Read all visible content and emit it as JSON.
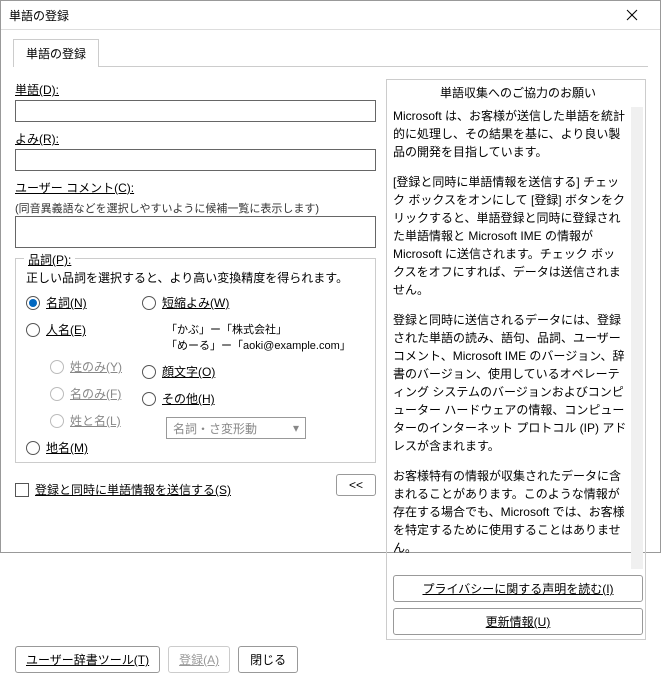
{
  "title": "単語の登録",
  "tab": "単語の登録",
  "fields": {
    "word_label": "単語(D):",
    "yomi_label": "よみ(R):",
    "comment_label": "ユーザー コメント(C):",
    "comment_hint": "(同音異義語などを選択しやすいように候補一覧に表示します)"
  },
  "pos": {
    "title": "品詞(P):",
    "desc": "正しい品詞を選択すると、より高い変換精度を得られます。",
    "noun": "名詞(N)",
    "person": "人名(E)",
    "surname_only": "姓のみ(Y)",
    "givenname_only": "名のみ(F)",
    "fullname": "姓と名(L)",
    "place": "地名(M)",
    "shortyomi": "短縮よみ(W)",
    "example1": "「かぶ」ー「株式会社」",
    "example2": "「めーる」ー「aoki@example.com」",
    "kaomoji": "顔文字(O)",
    "other": "その他(H)",
    "select_value": "名詞・さ変形動"
  },
  "send_checkbox": "登録と同時に単語情報を送信する(S)",
  "collapse_btn": "<<",
  "buttons": {
    "user_dict": "ユーザー辞書ツール(T)",
    "register": "登録(A)",
    "close": "閉じる"
  },
  "right": {
    "title": "単語収集へのご協力のお願い",
    "p1": "Microsoft は、お客様が送信した単語を統計的に処理し、その結果を基に、より良い製品の開発を目指しています。",
    "p2": "[登録と同時に単語情報を送信する] チェック ボックスをオンにして [登録] ボタンをクリックすると、単語登録と同時に登録された単語情報と Microsoft IME の情報が Microsoft に送信されます。チェック ボックスをオフにすれば、データは送信されません。",
    "p3": "登録と同時に送信されるデータには、登録された単語の読み、語句、品詞、ユーザー コメント、Microsoft IME のバージョン、辞書のバージョン、使用しているオペレーティング システムのバージョンおよびコンピューター ハードウェアの情報、コンピューターのインターネット プロトコル (IP) アドレスが含まれます。",
    "p4": "お客様特有の情報が収集されたデータに含まれることがあります。このような情報が存在する場合でも、Microsoft では、お客様を特定するために使用することはありません。",
    "privacy_btn": "プライバシーに関する声明を読む(I)",
    "update_btn": "更新情報(U)"
  }
}
